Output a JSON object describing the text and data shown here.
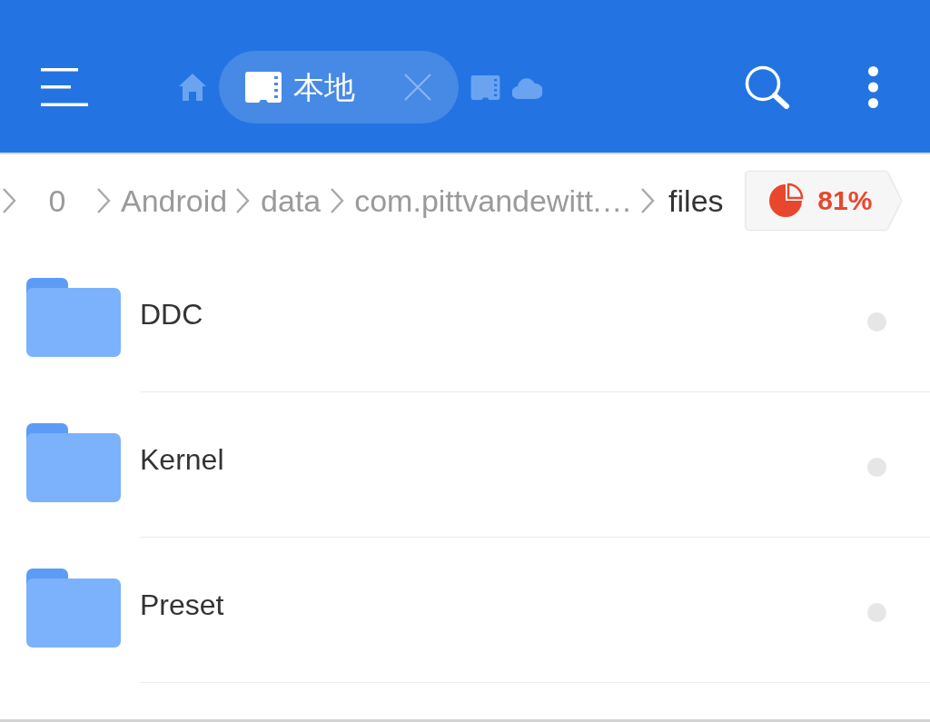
{
  "header": {
    "tabs": [
      {
        "kind": "home",
        "selected": false
      },
      {
        "kind": "sdcard",
        "label": "本地",
        "selected": true
      },
      {
        "kind": "sdcard",
        "selected": false
      },
      {
        "kind": "cloud",
        "selected": false
      }
    ]
  },
  "breadcrumb": {
    "items": [
      {
        "label": "0",
        "current": false
      },
      {
        "label": "Android",
        "current": false
      },
      {
        "label": "data",
        "current": false
      },
      {
        "label": "com.pittvandewitt.…",
        "current": false
      },
      {
        "label": "files",
        "current": true
      }
    ],
    "storage": {
      "label": "81%"
    }
  },
  "folders": [
    {
      "name": "DDC",
      "checked": false
    },
    {
      "name": "Kernel",
      "checked": false
    },
    {
      "name": "Preset",
      "checked": false
    }
  ]
}
